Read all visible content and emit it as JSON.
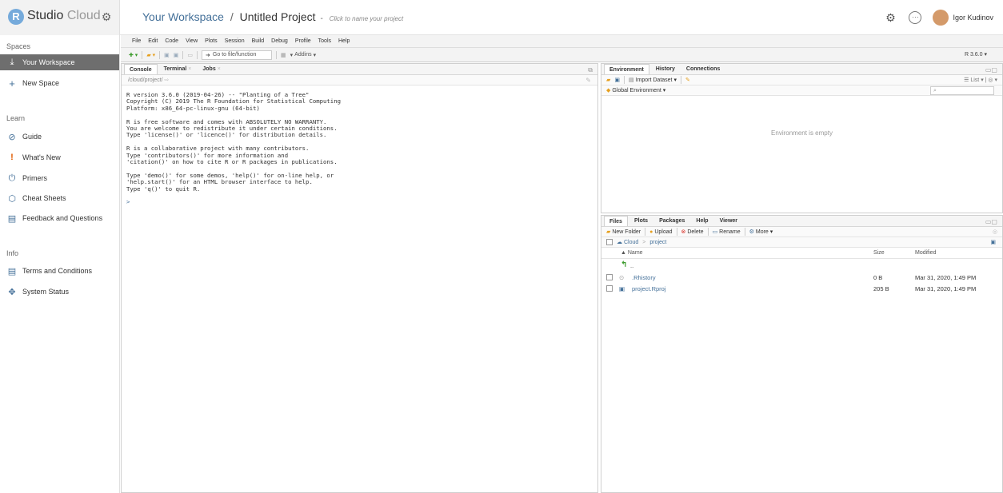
{
  "header": {
    "brand_logo_letter": "R",
    "brand_name": "Studio",
    "brand_suffix": "Cloud",
    "workspace": "Your Workspace",
    "separator": "/",
    "project": "Untitled Project",
    "dash": "-",
    "project_hint": "Click to name your project",
    "user_name": "Igor Kudinov"
  },
  "sidebar": {
    "spaces_label": "Spaces",
    "spaces": [
      {
        "label": "Your Workspace",
        "icon": "cloud-icon"
      },
      {
        "label": "New Space",
        "icon": "plus-icon"
      }
    ],
    "learn_label": "Learn",
    "learn": [
      {
        "label": "Guide",
        "icon": "compass-icon"
      },
      {
        "label": "What's New",
        "icon": "exclamation-icon"
      },
      {
        "label": "Primers",
        "icon": "power-icon"
      },
      {
        "label": "Cheat Sheets",
        "icon": "hexagon-icon"
      },
      {
        "label": "Feedback and Questions",
        "icon": "chat-icon"
      }
    ],
    "info_label": "Info",
    "info": [
      {
        "label": "Terms and Conditions",
        "icon": "document-icon"
      },
      {
        "label": "System Status",
        "icon": "status-icon"
      }
    ]
  },
  "menu": [
    "File",
    "Edit",
    "Code",
    "View",
    "Plots",
    "Session",
    "Build",
    "Debug",
    "Profile",
    "Tools",
    "Help"
  ],
  "toolbar": {
    "goto_placeholder": "Go to file/function",
    "addins": "Addins",
    "r_version": "R 3.6.0"
  },
  "console": {
    "tabs": [
      "Console",
      "Terminal",
      "Jobs"
    ],
    "path": "/cloud/project/",
    "lines": [
      "R version 3.6.0 (2019-04-26) -- \"Planting of a Tree\"",
      "Copyright (C) 2019 The R Foundation for Statistical Computing",
      "Platform: x86_64-pc-linux-gnu (64-bit)",
      "",
      "R is free software and comes with ABSOLUTELY NO WARRANTY.",
      "You are welcome to redistribute it under certain conditions.",
      "Type 'license()' or 'licence()' for distribution details.",
      "",
      "R is a collaborative project with many contributors.",
      "Type 'contributors()' for more information and",
      "'citation()' on how to cite R or R packages in publications.",
      "",
      "Type 'demo()' for some demos, 'help()' for on-line help, or",
      "'help.start()' for an HTML browser interface to help.",
      "Type 'q()' to quit R.",
      ""
    ],
    "prompt": ">"
  },
  "environment": {
    "tabs": [
      "Environment",
      "History",
      "Connections"
    ],
    "import_dataset": "Import Dataset",
    "list_label": "List",
    "global_env": "Global Environment",
    "empty_text": "Environment is empty"
  },
  "files": {
    "tabs": [
      "Files",
      "Plots",
      "Packages",
      "Help",
      "Viewer"
    ],
    "actions": [
      "New Folder",
      "Upload",
      "Delete",
      "Rename",
      "More"
    ],
    "breadcrumb_root": "Cloud",
    "breadcrumb_sep": ">",
    "breadcrumb_dir": "project",
    "columns": {
      "name": "▲ Name",
      "size": "Size",
      "modified": "Modified"
    },
    "up_label": "..",
    "rows": [
      {
        "name": ".Rhistory",
        "size": "0 B",
        "modified": "Mar 31, 2020, 1:49 PM"
      },
      {
        "name": "project.Rproj",
        "size": "205 B",
        "modified": "Mar 31, 2020, 1:49 PM"
      }
    ]
  }
}
